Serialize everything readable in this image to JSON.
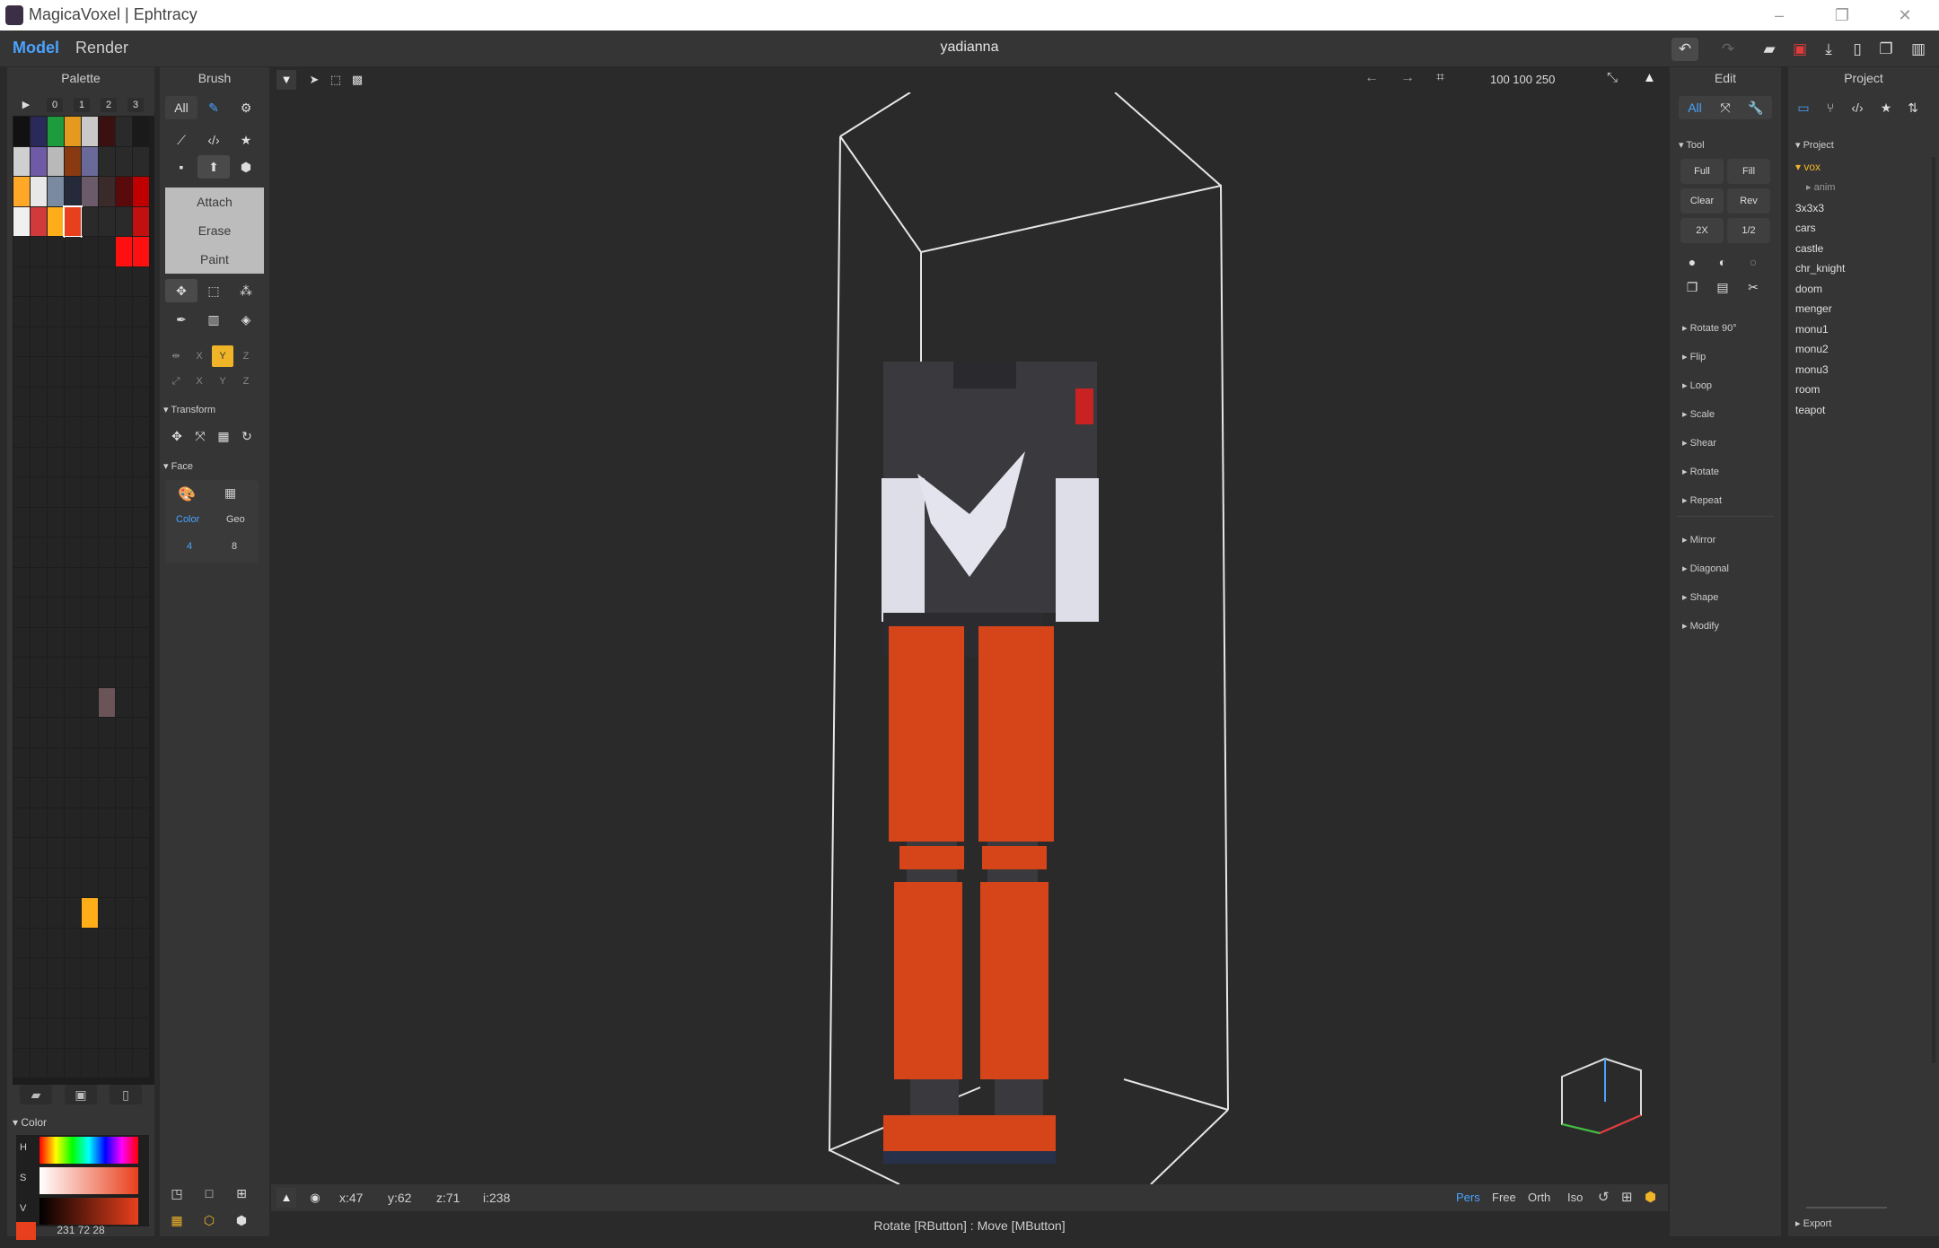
{
  "app": {
    "title": "MagicaVoxel | Ephtracy",
    "window_controls": [
      "–",
      "❐",
      "✕"
    ]
  },
  "menu": {
    "model": "Model",
    "render": "Render",
    "filename": "yadianna"
  },
  "toolbar_right": {
    "icons": [
      "undo-icon",
      "redo-icon",
      "open-icon",
      "save-icon",
      "export-icon",
      "new-icon",
      "copy-icon",
      "delete-icon"
    ]
  },
  "palette": {
    "title": "Palette",
    "pages": [
      "▶",
      "0",
      "1",
      "2",
      "3"
    ],
    "colors": [
      "#111111",
      "#2a2a5a",
      "#1e9b3c",
      "#e39a1e",
      "#c9c9c9",
      "#3a1010",
      "#2a2a2a",
      "#1a1a1a",
      "#cfcfcf",
      "#6f5aa5",
      "#b9b9b9",
      "#8a3a10",
      "#6a6a9a",
      "#2a2a2a",
      "#2a2a2a",
      "#2a2a2a",
      "#ffa726",
      "#e8e8e8",
      "#7a8aa0",
      "#242a3a",
      "#6a5a6a",
      "#3a2a2a",
      "#5a0a0a",
      "#c00000",
      "#f0f0f0",
      "#d03a3a",
      "#ffae1a",
      "#e8401c",
      "#2a2a2a",
      "#2a2a2a",
      "#2a2a2a",
      "#c01010"
    ],
    "extra_red": "#ff1010",
    "extra_pink": "#6a5458",
    "extra_orange": "#ffae1a",
    "color_section": "Color",
    "hsv_labels": [
      "H",
      "S",
      "V"
    ],
    "selected_color": "#e8401c",
    "rgb": "231 72 28"
  },
  "brush": {
    "title": "Brush",
    "all": "All",
    "modes": [
      "Attach",
      "Erase",
      "Paint"
    ],
    "axes1": [
      "X",
      "Y",
      "Z"
    ],
    "axes2": [
      "X",
      "Y",
      "Z"
    ],
    "transform": "Transform",
    "face": "Face",
    "face_color": "Color",
    "face_geo": "Geo",
    "face_color_n": "4",
    "face_geo_n": "8"
  },
  "viewport": {
    "dims": "100  100  250",
    "coords": {
      "x": "x:47",
      "y": "y:62",
      "z": "z:71",
      "i": "i:238"
    },
    "views": [
      "Pers",
      "Free",
      "Orth",
      "Iso"
    ],
    "status": "Rotate [RButton] : Move [MButton]"
  },
  "edit": {
    "title": "Edit",
    "all": "All",
    "tool": "Tool",
    "buttons": [
      "Full",
      "Fill",
      "Clear",
      "Rev",
      "2X",
      "1/2"
    ],
    "items": [
      "Rotate 90°",
      "Flip",
      "Loop",
      "Scale",
      "Shear",
      "Rotate",
      "Repeat",
      "Mirror",
      "Diagonal",
      "Shape",
      "Modify"
    ]
  },
  "project": {
    "title": "Project",
    "tree_root": "Project",
    "folder": "vox",
    "sub": "anim",
    "files": [
      "3x3x3",
      "cars",
      "castle",
      "chr_knight",
      "doom",
      "menger",
      "monu1",
      "monu2",
      "monu3",
      "room",
      "teapot"
    ],
    "export": "Export"
  }
}
